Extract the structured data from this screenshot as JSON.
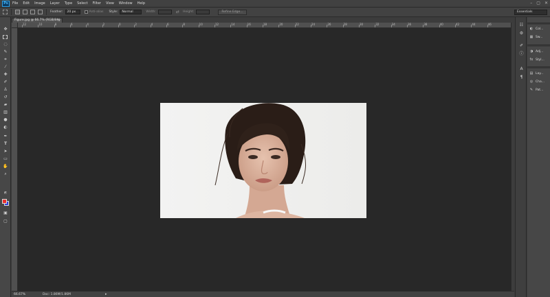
{
  "app": {
    "logo": "Ps"
  },
  "menu": [
    "File",
    "Edit",
    "Image",
    "Layer",
    "Type",
    "Select",
    "Filter",
    "View",
    "Window",
    "Help"
  ],
  "window_controls": [
    "–",
    "▢",
    "✕"
  ],
  "options": {
    "feather_label": "Feather:",
    "feather_value": "20 px",
    "antialias_label": "Anti-alias",
    "style_label": "Style:",
    "style_value": "Normal",
    "width_label": "Width:",
    "height_label": "Height:",
    "refine_label": "Refine Edge...",
    "workspace": "Essentials"
  },
  "document": {
    "tab_title": "Figure.jpg @ 66.7% (RGB/8#)",
    "close": "×"
  },
  "ruler_ticks": [
    "12",
    "10",
    "8",
    "6",
    "4",
    "2",
    "0",
    "2",
    "4",
    "6",
    "8",
    "10",
    "12",
    "14",
    "16",
    "18",
    "20",
    "22",
    "24",
    "26",
    "28",
    "30",
    "32",
    "34",
    "36",
    "38",
    "40",
    "42",
    "44",
    "46"
  ],
  "status": {
    "zoom": "66.67%",
    "doc_info": "Doc: 1.86M/1.86M",
    "arrow": "▸"
  },
  "panels": [
    {
      "icon": "color-icon",
      "glyph": "◐",
      "label": "Col..."
    },
    {
      "icon": "swatches-icon",
      "glyph": "▦",
      "label": "Sw..."
    },
    {
      "icon": "adjustments-icon",
      "glyph": "◑",
      "label": "Adj..."
    },
    {
      "icon": "styles-icon",
      "glyph": "fx",
      "label": "Styl..."
    },
    {
      "icon": "layers-icon",
      "glyph": "▤",
      "label": "Lay..."
    },
    {
      "icon": "channels-icon",
      "glyph": "◎",
      "label": "Cha..."
    },
    {
      "icon": "paths-icon",
      "glyph": "✎",
      "label": "Pat..."
    }
  ],
  "colors": {
    "foreground": "#e8322f",
    "background": "#2c3fd8",
    "canvas": "#282828"
  }
}
